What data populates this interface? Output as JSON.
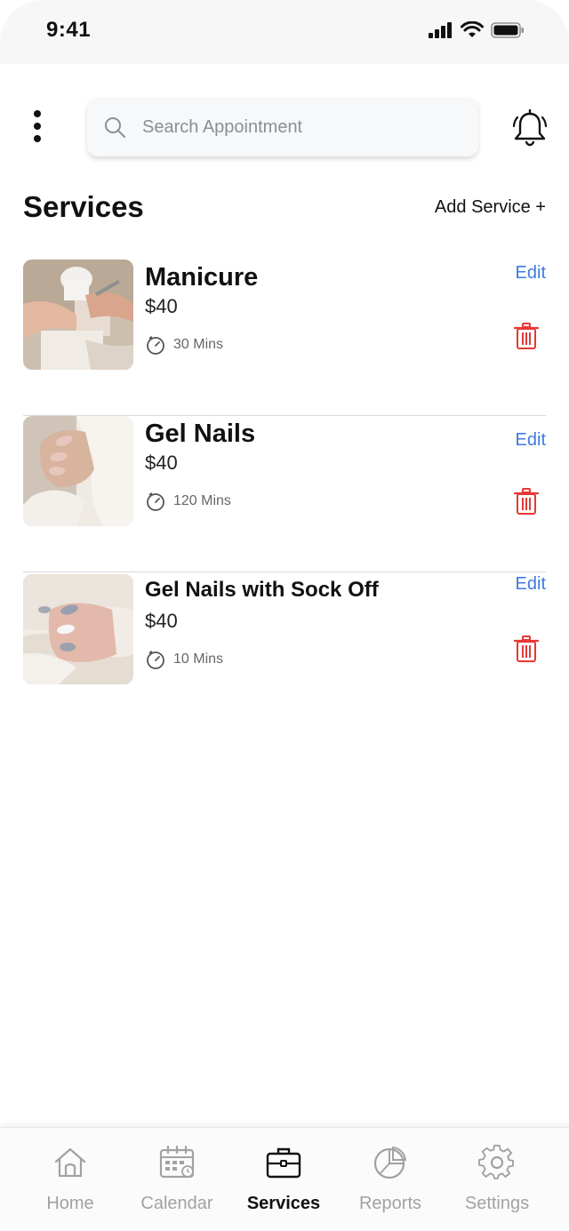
{
  "status_bar": {
    "time": "9:41"
  },
  "header": {
    "search_placeholder": "Search Appointment"
  },
  "section": {
    "title": "Services",
    "add_label": "Add Service +"
  },
  "services": [
    {
      "name": "Manicure",
      "price": "$40",
      "duration": "30 Mins",
      "edit_label": "Edit",
      "image": "manicure-photo"
    },
    {
      "name": "Gel Nails",
      "price": "$40",
      "duration": "120 Mins",
      "edit_label": "Edit",
      "image": "gel-nails-photo"
    },
    {
      "name": "Gel Nails with Sock Off",
      "price": "$40",
      "duration": "10 Mins",
      "edit_label": "Edit",
      "image": "gel-nails-sock-off-photo"
    }
  ],
  "tab_bar": {
    "tabs": [
      {
        "label": "Home",
        "icon": "home-icon",
        "active": false
      },
      {
        "label": "Calendar",
        "icon": "calendar-icon",
        "active": false
      },
      {
        "label": "Services",
        "icon": "briefcase-icon",
        "active": true
      },
      {
        "label": "Reports",
        "icon": "pie-chart-icon",
        "active": false
      },
      {
        "label": "Settings",
        "icon": "gear-icon",
        "active": false
      }
    ]
  },
  "colors": {
    "accent": "#3c7be0",
    "danger": "#e53935",
    "text": "#111111",
    "muted": "#a2a2a2"
  }
}
